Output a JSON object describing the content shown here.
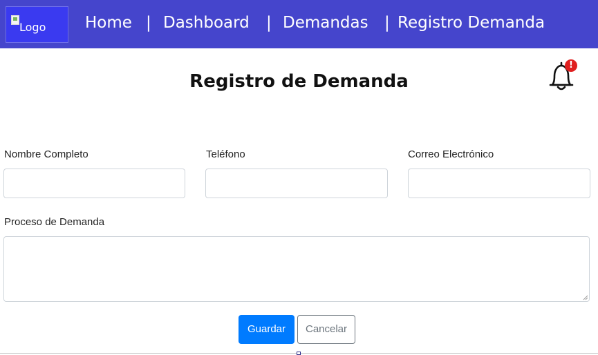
{
  "navbar": {
    "logo_alt": "Logo",
    "links": [
      "Home",
      "Dashboard",
      "Demandas",
      "Registro Demanda"
    ],
    "separator": "|",
    "bg_color": "#4545cc"
  },
  "header": {
    "title": "Registro de Demanda",
    "bell_icon": "bell-icon",
    "notification_badge": "!",
    "badge_color": "#e02020"
  },
  "form": {
    "fields": [
      {
        "label": "Nombre Completo",
        "value": "",
        "placeholder": ""
      },
      {
        "label": "Teléfono",
        "value": "",
        "placeholder": ""
      },
      {
        "label": "Correo Electrónico",
        "value": "",
        "placeholder": ""
      }
    ],
    "process_label": "Proceso de Demanda",
    "process_value": "",
    "save_label": "Guardar",
    "cancel_label": "Cancelar",
    "primary_color": "#007bff",
    "secondary_color": "#6c757d"
  }
}
